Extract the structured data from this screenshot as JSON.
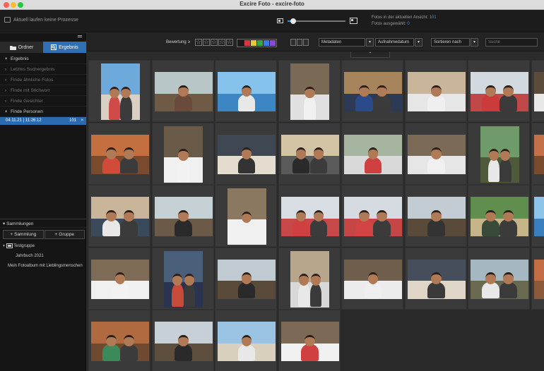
{
  "window": {
    "title": "Excire Foto - excire-foto"
  },
  "status": {
    "processes": "Aktuell laufen keine Prozesse",
    "photos_in_view_label": "Fotos in der aktuellen Ansicht:",
    "photos_in_view_count": "101",
    "selected_label": "Fotos ausgewählt:",
    "selected_count": "0"
  },
  "zoom": {
    "level": 0.1
  },
  "sidebar": {
    "tabs": [
      {
        "label": "Ordner"
      },
      {
        "label": "Ergebnis"
      }
    ],
    "result_header": "Ergebnis",
    "items": [
      {
        "label": "Letztes Suchergebnis"
      },
      {
        "label": "Finde ähnliche Fotos"
      },
      {
        "label": "Finde mit Stichwort"
      },
      {
        "label": "Finde Gesichter"
      },
      {
        "label": "Finde Personen"
      }
    ],
    "person_result": {
      "date": "04.11.21 | 11:26:12",
      "count": "101"
    },
    "collections": {
      "header": "Sammlungen",
      "add_collection": "Sammlung",
      "add_group": "Gruppe",
      "items": [
        {
          "label": "Testgruppe"
        },
        {
          "label": "Jahrbuch 2021"
        },
        {
          "label": "Mein Fotoalbum mit Lieblingsmenschen"
        }
      ]
    }
  },
  "toolbar": {
    "rating_label": "Bewertung",
    "rating_op": "≥",
    "metadata": "Metadaten",
    "date": "Aufnahmedatum",
    "sort": "Sortieren nach",
    "search_placeholder": "Suche"
  },
  "label_colors": [
    "#1a1a1a",
    "#d33b3b",
    "#e8c930",
    "#36a545",
    "#3b7be0",
    "#8a4bd0"
  ],
  "photos": [
    {
      "kind": "beach",
      "sky": "#6ea9dc",
      "ground": "#d9cfc2",
      "people": 2,
      "shirt": "#d04a4a"
    },
    {
      "kind": "patio",
      "sky": "#b8c6c8",
      "ground": "#6f5a45",
      "people": 1,
      "shirt": "#6a4a3a"
    },
    {
      "kind": "sea",
      "sky": "#86c3ec",
      "ground": "#3c86c4",
      "people": 1,
      "shirt": "#e8e8e8"
    },
    {
      "kind": "books",
      "sky": "#7a6a55",
      "ground": "#e0e0e0",
      "people": 1,
      "shirt": "#f0f0f0"
    },
    {
      "kind": "selfie",
      "sky": "#a7855c",
      "ground": "#2d3a55",
      "people": 2,
      "shirt": "#2c4a8a"
    },
    {
      "kind": "books",
      "sky": "#c9b69a",
      "ground": "#e6e6e6",
      "people": 1,
      "shirt": "#efefef"
    },
    {
      "kind": "selfie",
      "sky": "#d2d9df",
      "ground": "#c04848",
      "people": 2,
      "shirt": "#cc3b3b"
    },
    {
      "kind": "books",
      "sky": "#5c4a3a",
      "ground": "#e8e8e8",
      "people": 1,
      "shirt": "#f2f2f2"
    },
    {
      "kind": "room",
      "sky": "#c46f3f",
      "ground": "#7a4a2f",
      "people": 2,
      "shirt": "#d24b3a"
    },
    {
      "kind": "books",
      "sky": "#6a5a48",
      "ground": "#f0f0f0",
      "people": 1,
      "shirt": "#f2f2f2"
    },
    {
      "kind": "xmas",
      "sky": "#3e4752",
      "ground": "#e5dcd0",
      "people": 1,
      "shirt": "#333"
    },
    {
      "kind": "pair",
      "sky": "#d2c4a5",
      "ground": "#5a5a5a",
      "people": 2,
      "shirt": "#2a2a2a"
    },
    {
      "kind": "room",
      "sky": "#a6b5a0",
      "ground": "#d9d9d9",
      "people": 1,
      "shirt": "#d04040"
    },
    {
      "kind": "books",
      "sky": "#7b6a55",
      "ground": "#e6e6e6",
      "people": 1,
      "shirt": "#f0f0f0"
    },
    {
      "kind": "pair",
      "sky": "#6f9a6a",
      "ground": "#4f5a3a",
      "people": 2,
      "shirt": "#e8e8e8"
    },
    {
      "kind": "room",
      "sky": "#c47048",
      "ground": "#7a4a2f",
      "people": 2,
      "shirt": "#c94a3a"
    },
    {
      "kind": "selfie",
      "sky": "#c9b59a",
      "ground": "#3a4a5a",
      "people": 2,
      "shirt": "#e8e8e8"
    },
    {
      "kind": "patio",
      "sky": "#c5d0d4",
      "ground": "#6b5a48",
      "people": 1,
      "shirt": "#2a2a2a"
    },
    {
      "kind": "books",
      "sky": "#8a7860",
      "ground": "#f0f0f0",
      "people": 1,
      "shirt": "#f0f0f0"
    },
    {
      "kind": "selfie",
      "sky": "#d7dde3",
      "ground": "#c74848",
      "people": 2,
      "shirt": "#d04040"
    },
    {
      "kind": "selfie",
      "sky": "#d5dbe1",
      "ground": "#c64545",
      "people": 2,
      "shirt": "#d24444"
    },
    {
      "kind": "patio",
      "sky": "#c2ccd2",
      "ground": "#5a4a3a",
      "people": 1,
      "shirt": "#333"
    },
    {
      "kind": "pair",
      "sky": "#5f8e4e",
      "ground": "#c7b58a",
      "people": 2,
      "shirt": "#3a4a3a"
    },
    {
      "kind": "sea",
      "sky": "#8fc4ea",
      "ground": "#3a7fbe",
      "people": 1,
      "shirt": "#f0f0f0"
    },
    {
      "kind": "books",
      "sky": "#7d6b55",
      "ground": "#f0f0f0",
      "people": 1,
      "shirt": "#f2f2f2"
    },
    {
      "kind": "selfie",
      "sky": "#4a5f7a",
      "ground": "#2a3450",
      "people": 2,
      "shirt": "#c84a3a"
    },
    {
      "kind": "patio",
      "sky": "#c0cbd1",
      "ground": "#5a4a3a",
      "people": 1,
      "shirt": "#2a2a2a"
    },
    {
      "kind": "selfie",
      "sky": "#b8a68c",
      "ground": "#d8d8d8",
      "people": 2,
      "shirt": "#e8e8e8"
    },
    {
      "kind": "books",
      "sky": "#6f5e4b",
      "ground": "#ececec",
      "people": 1,
      "shirt": "#efefef"
    },
    {
      "kind": "xmas",
      "sky": "#454e5a",
      "ground": "#e0d6c8",
      "people": 1,
      "shirt": "#3a3a3a"
    },
    {
      "kind": "pair",
      "sky": "#a5b8c2",
      "ground": "#6a6a50",
      "people": 2,
      "shirt": "#e8e8e8"
    },
    {
      "kind": "room",
      "sky": "#c26d44",
      "ground": "#8a5a3a",
      "people": 1,
      "shirt": "#d04040"
    },
    {
      "kind": "room",
      "sky": "#b06a3f",
      "ground": "#6e4a30",
      "people": 2,
      "shirt": "#3a8a5a"
    },
    {
      "kind": "patio",
      "sky": "#c6d0d6",
      "ground": "#5e4e3e",
      "people": 1,
      "shirt": "#2a2a2a"
    },
    {
      "kind": "beach",
      "sky": "#9bc4e4",
      "ground": "#d9cfbd",
      "people": 1,
      "shirt": "#e8e8e8"
    },
    {
      "kind": "books",
      "sky": "#7c6a56",
      "ground": "#f0f0f0",
      "people": 1,
      "shirt": "#d04040"
    }
  ]
}
